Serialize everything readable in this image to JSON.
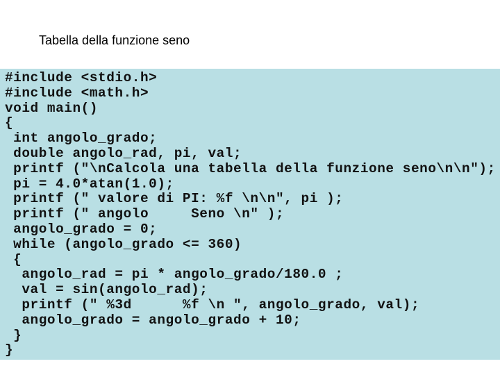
{
  "slide": {
    "title": "Tabella della funzione seno",
    "code_lines": [
      "#include <stdio.h>",
      "#include <math.h>",
      "void main()",
      "{",
      " int angolo_grado;",
      " double angolo_rad, pi, val;",
      " printf (\"\\nCalcola una tabella della funzione seno\\n\\n\");",
      " pi = 4.0*atan(1.0);",
      " printf (\" valore di PI: %f \\n\\n\", pi );",
      " printf (\" angolo     Seno \\n\" );",
      " angolo_grado = 0;",
      " while (angolo_grado <= 360)",
      " {",
      "  angolo_rad = pi * angolo_grado/180.0 ;",
      "  val = sin(angolo_rad);",
      "  printf (\" %3d      %f \\n \", angolo_grado, val);",
      "  angolo_grado = angolo_grado + 10;",
      " }",
      "}"
    ]
  }
}
